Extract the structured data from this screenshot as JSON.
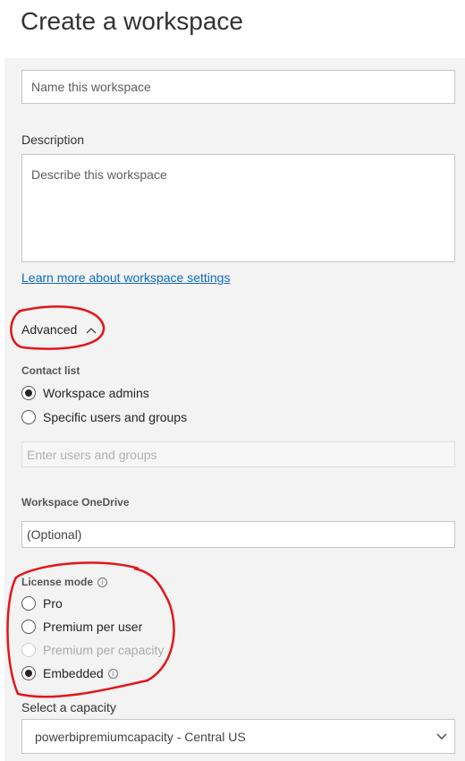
{
  "title": "Create a workspace",
  "name_input": {
    "placeholder": "Name this workspace"
  },
  "description": {
    "label": "Description",
    "placeholder": "Describe this workspace"
  },
  "learn_more_link": "Learn more about workspace settings",
  "advanced": {
    "label": "Advanced",
    "chevron": "^"
  },
  "contact_list": {
    "label": "Contact list",
    "options": [
      {
        "label": "Workspace admins",
        "selected": true
      },
      {
        "label": "Specific users and groups",
        "selected": false
      }
    ],
    "users_placeholder": "Enter users and groups"
  },
  "onedrive": {
    "label": "Workspace OneDrive",
    "placeholder": "(Optional)"
  },
  "license_mode": {
    "label": "License mode",
    "info_icon": "i",
    "options": [
      {
        "label": "Pro",
        "selected": false
      },
      {
        "label": "Premium per user",
        "selected": false
      },
      {
        "label": "Premium per capacity",
        "selected": false,
        "disabled": true
      },
      {
        "label": "Embedded",
        "selected": true
      }
    ]
  },
  "capacity": {
    "label": "Select a capacity",
    "value": "powerbipremiumcapacity - Central US"
  },
  "annotation_color": "#e3161b"
}
